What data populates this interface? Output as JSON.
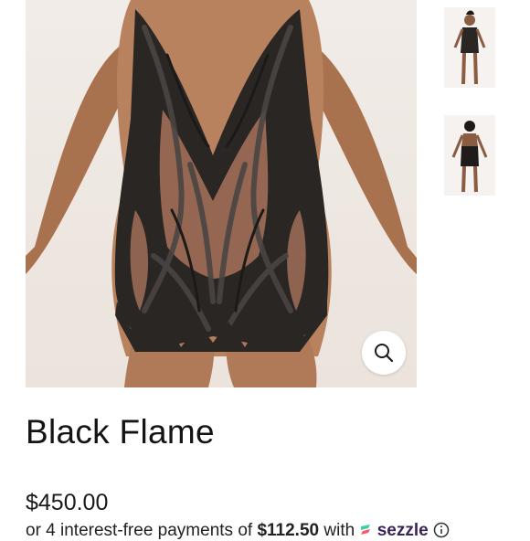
{
  "product": {
    "title": "Black Flame",
    "price": "$450.00"
  },
  "installments": {
    "text_before": "or 4 interest-free payments of",
    "amount": "$112.50",
    "text_after": "with",
    "provider": "sezzle"
  },
  "gallery": {
    "thumbnail_count": 2
  },
  "icons": {
    "zoom": "magnifier-icon",
    "info": "info-icon"
  },
  "colors": {
    "dress": "#2a2624",
    "skin": "#b07a58",
    "sezzle_brand": "#392558",
    "sezzle_accent": "#3fd0a6"
  }
}
